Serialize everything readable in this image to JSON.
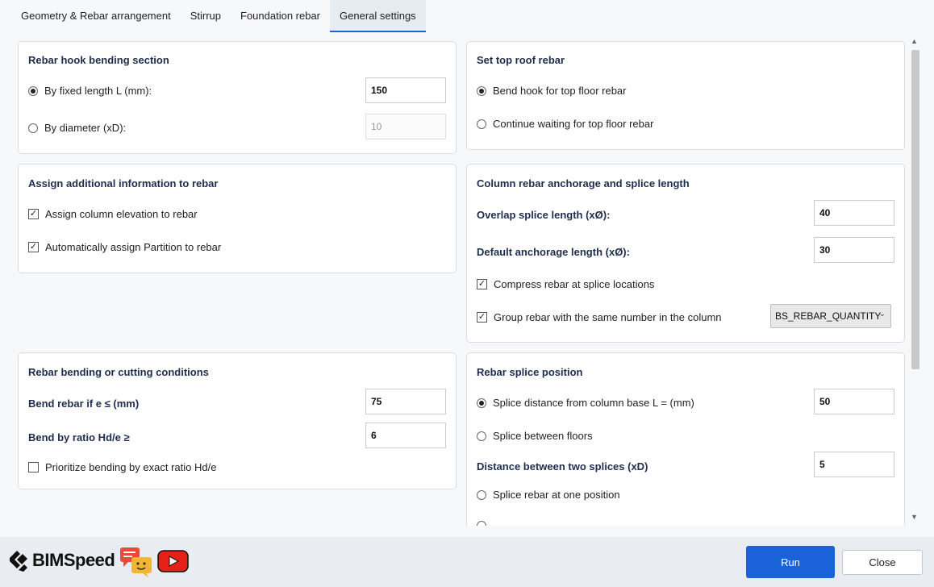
{
  "tabs": [
    {
      "label": "Geometry & Rebar arrangement"
    },
    {
      "label": "Stirrup"
    },
    {
      "label": "Foundation rebar"
    },
    {
      "label": "General settings"
    }
  ],
  "hook": {
    "title": "Rebar hook bending section",
    "fixed_label": "By fixed length L (mm):",
    "fixed_value": "150",
    "diameter_label": "By diameter (xD):",
    "diameter_value": "10"
  },
  "roof": {
    "title": "Set top roof rebar",
    "bend_label": "Bend hook for top floor rebar",
    "continue_label": "Continue waiting for top floor rebar"
  },
  "assign": {
    "title": "Assign additional information to rebar",
    "elevation_label": "Assign column elevation to rebar",
    "partition_label": "Automatically assign Partition to rebar"
  },
  "anchorage": {
    "title": "Column rebar anchorage and splice length",
    "overlap_label": "Overlap splice length (xØ):",
    "overlap_value": "40",
    "default_label": "Default anchorage length (xØ):",
    "default_value": "30",
    "compress_label": "Compress rebar at splice locations",
    "group_label": "Group rebar with the same number in the column",
    "group_select": "BS_REBAR_QUANTITY"
  },
  "bending": {
    "title": "Rebar bending or cutting conditions",
    "bend_e_label": "Bend rebar if e ≤ (mm)",
    "bend_e_value": "75",
    "ratio_label": "Bend by ratio Hd/e ≥",
    "ratio_value": "6",
    "prioritize_label": "Prioritize bending by exact ratio Hd/e"
  },
  "splice": {
    "title": "Rebar splice position",
    "distance_label": "Splice distance from column base L = (mm)",
    "distance_value": "50",
    "between_floors_label": "Splice between floors",
    "two_splices_label": "Distance between two splices (xD)",
    "two_splices_value": "5",
    "one_position_label": "Splice rebar at one position"
  },
  "footer": {
    "brand": "BIMSpeed",
    "run_label": "Run",
    "close_label": "Close"
  },
  "colors": {
    "accent": "#1a62d8",
    "title": "#1f2d4d",
    "youtube": "#e62117",
    "chat": "#e84a3a"
  }
}
